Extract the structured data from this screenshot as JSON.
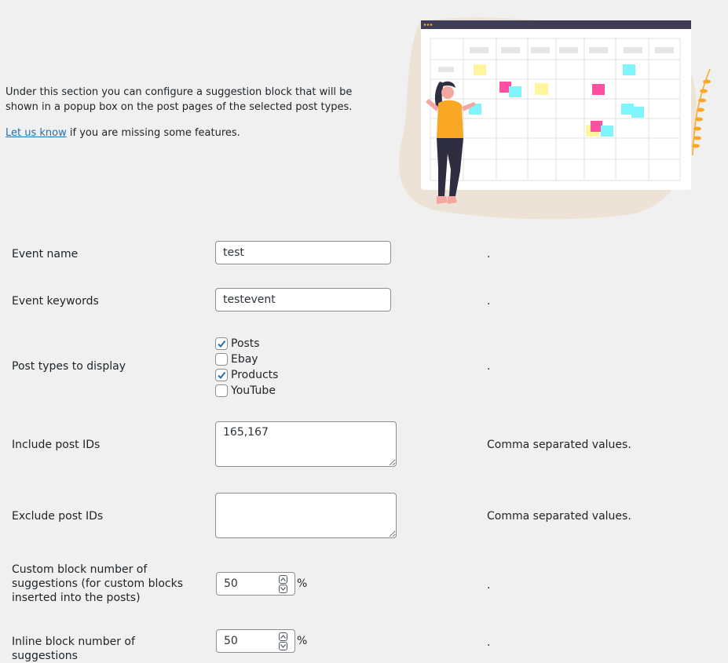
{
  "intro": {
    "text": "Under this section you can configure a suggestion block that will be shown in a popup box on the post pages of the selected post types.",
    "link_text": "Let us know",
    "link_suffix": " if you are missing some features."
  },
  "fields": {
    "event_name": {
      "label": "Event name",
      "value": "test",
      "desc": "."
    },
    "event_keywords": {
      "label": "Event keywords",
      "value": "testevent",
      "desc": "."
    },
    "post_types": {
      "label": "Post types to display",
      "desc": ".",
      "options": [
        {
          "label": "Posts",
          "checked": true
        },
        {
          "label": "Ebay",
          "checked": false
        },
        {
          "label": "Products",
          "checked": true
        },
        {
          "label": "YouTube",
          "checked": false
        }
      ]
    },
    "include_ids": {
      "label": "Include post IDs",
      "value": "165,167",
      "desc": "Comma separated values."
    },
    "exclude_ids": {
      "label": "Exclude post IDs",
      "value": "",
      "desc": "Comma separated values."
    },
    "custom_block": {
      "label": "Custom block number of suggestions (for custom blocks inserted into the posts)",
      "value": "50",
      "unit": "%",
      "desc": "."
    },
    "inline_block": {
      "label": "Inline block number of suggestions",
      "value": "50",
      "unit": "%",
      "desc": "."
    }
  },
  "colors": {
    "background": "#f0f0f1",
    "link": "#2271b1",
    "checkmark": "#2271b1",
    "blob": "#ece3d6",
    "window_bar": "#3f3d56",
    "note_yellow": "#fff59d",
    "note_pink": "#ff4fa0",
    "note_cyan": "#7ff5fb",
    "person_top": "#f9a825",
    "person_pants": "#2f2e41",
    "leaf": "#f9a825"
  }
}
